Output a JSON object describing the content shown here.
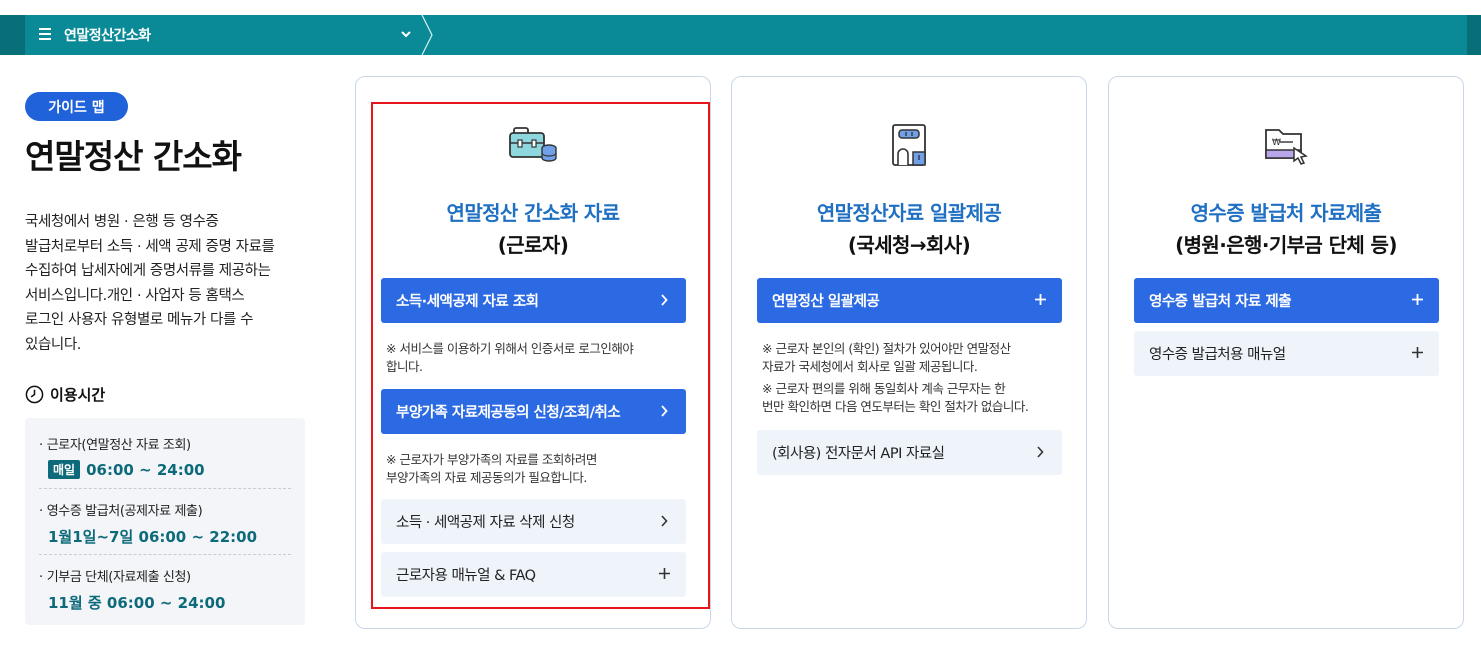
{
  "topnav": {
    "menu_title": "연말정산간소화"
  },
  "sidebar": {
    "guide_label": "가이드 맵",
    "page_title": "연말정산 간소화",
    "description": "국세청에서 병원 · 은행 등 영수증\n발급처로부터 소득 · 세액 공제 증명 자료를\n수집하여 납세자에게 증명서류를 제공하는\n서비스입니다.개인 · 사업자 등 홈택스\n로그인 사용자 유형별로 메뉴가 다를 수\n있습니다.",
    "hours_title": "이용시간",
    "hours": [
      {
        "label": "근로자(연말정산 자료 조회)",
        "badge": "매일",
        "time": "06:00 ~ 24:00"
      },
      {
        "label": "영수증 발급처(공제자료 제출)",
        "time": "1월1일~7일 06:00 ~ 22:00"
      },
      {
        "label": "기부금 단체(자료제출 신청)",
        "time": "11월 중 06:00 ~ 24:00"
      }
    ]
  },
  "cards": [
    {
      "icon": "briefcase-coins-icon",
      "title": "연말정산 간소화 자료",
      "subtitle": "(근로자)",
      "btn1": "소득·세액공제 자료 조회",
      "note1": "※ 서비스를 이용하기 위해서 인증서로 로그인해야\n합니다.",
      "btn2": "부양가족 자료제공동의 신청/조회/취소",
      "note2": "※ 근로자가 부양가족의 자료를 조회하려면\n부양가족의 자료 제공동의가 필요합니다.",
      "btn3": "소득 · 세액공제 자료 삭제 신청",
      "btn4": "근로자용 매뉴얼 & FAQ"
    },
    {
      "icon": "building-icon",
      "title": "연말정산자료 일괄제공",
      "subtitle": "(국세청→회사)",
      "btn1": "연말정산 일괄제공",
      "note1": "※ 근로자 본인의 (확인) 절차가 있어야만 연말정산\n자료가 국세청에서 회사로 일괄 제공됩니다.",
      "note2": "※ 근로자 편의를 위해 동일회사 계속 근무자는 한\n번만 확인하면 다음 연도부터는 확인 절차가 없습니다.",
      "btn2": "(회사용) 전자문서 API 자료실"
    },
    {
      "icon": "folder-cursor-icon",
      "title": "영수증 발급처 자료제출",
      "subtitle": "(병원·은행·기부금 단체 등)",
      "btn1": "영수증 발급처 자료 제출",
      "btn2": "영수증 발급처용 매뉴얼"
    }
  ],
  "colors": {
    "nav": "#0a8a96",
    "primary_button": "#2b6ae3",
    "card_title": "#1f6fc2",
    "highlight": "#e8141b"
  }
}
